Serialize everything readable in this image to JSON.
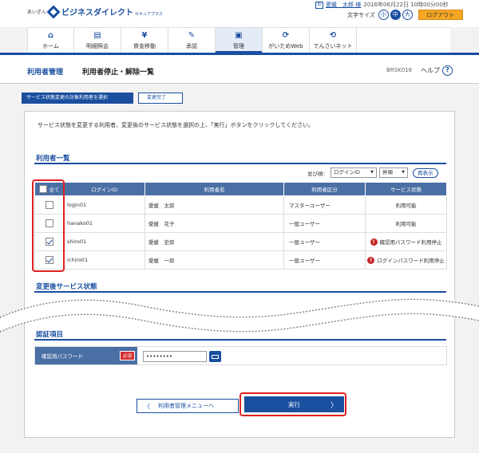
{
  "header": {
    "logo_sub": "あいぎん",
    "logo_main": "ビジネスダイレクト",
    "logo_tiny": "セキュアプラス",
    "user_icon": "ID",
    "user_name": "愛媛　太郎 様",
    "login_time": "2016年06月22日 10時00分00秒",
    "font_size_label": "文字サイズ",
    "font_sizes": [
      "小",
      "中",
      "大"
    ],
    "font_size_active": "中",
    "logout_label": "ログアウト"
  },
  "nav": {
    "items": [
      {
        "label": "ホーム",
        "icon": "home-icon",
        "glyph": "⌂"
      },
      {
        "label": "明細照会",
        "icon": "document-icon",
        "glyph": "▤"
      },
      {
        "label": "資金移動",
        "icon": "yen-icon",
        "glyph": "¥"
      },
      {
        "label": "承認",
        "icon": "approval-icon",
        "glyph": "✎"
      },
      {
        "label": "管理",
        "icon": "management-icon",
        "glyph": "▣"
      },
      {
        "label": "がいためWeb",
        "icon": "foreign-exchange-icon",
        "glyph": "⟳"
      },
      {
        "label": "でんさいネット",
        "icon": "densai-icon",
        "glyph": "⟲"
      }
    ],
    "active": "管理"
  },
  "titlebar": {
    "crumb_parent": "利用者管理",
    "crumb_current": "利用者停止・解除一覧",
    "screen_id": "BRSK016",
    "help_label": "ヘルプ",
    "help_glyph": "?"
  },
  "steps": [
    "サービス状態変更の対象利用者を選択",
    "変更完了"
  ],
  "instruction": "サービス状態を変更する利用者、変更後のサービス状態を選択の上、「実行」ボタンをクリックしてください。",
  "user_list": {
    "section_title": "利用者一覧",
    "sort_label": "並び順：",
    "sort_key": "ログインID",
    "sort_order": "昇順",
    "resort_label": "再表示",
    "headers": {
      "all": "全て",
      "login_id": "ログインID",
      "name": "利用者名",
      "kubun": "利用者区分",
      "status": "サービス状態"
    },
    "rows": [
      {
        "checked": false,
        "login_id": "login01",
        "name": "愛媛　太郎",
        "kubun": "マスターユーザー",
        "status": "利用可能",
        "warn": false
      },
      {
        "checked": false,
        "login_id": "hanako01",
        "name": "愛媛　花子",
        "kubun": "一般ユーザー",
        "status": "利用可能",
        "warn": false
      },
      {
        "checked": true,
        "login_id": "shiro01",
        "name": "愛媛　史郎",
        "kubun": "一般ユーザー",
        "status": "確認用パスワード利用停止",
        "warn": true
      },
      {
        "checked": true,
        "login_id": "ichiro01",
        "name": "愛媛　一郎",
        "kubun": "一般ユーザー",
        "status": "ログインパスワード利用停止",
        "warn": true
      }
    ]
  },
  "after_status": {
    "section_title": "変更後サービス状態"
  },
  "auth": {
    "section_title": "認証項目",
    "password_label": "確認用パスワード",
    "required_label": "必須",
    "password_value": "••••••••"
  },
  "buttons": {
    "back_label": "利用者管理メニューへ",
    "back_arrow": "〈",
    "exec_label": "実行",
    "exec_arrow": "〉"
  },
  "colors": {
    "brand": "#1a4fa0",
    "header_cell": "#4a6fa5",
    "highlight": "#e02020",
    "logout": "#f5a623"
  }
}
